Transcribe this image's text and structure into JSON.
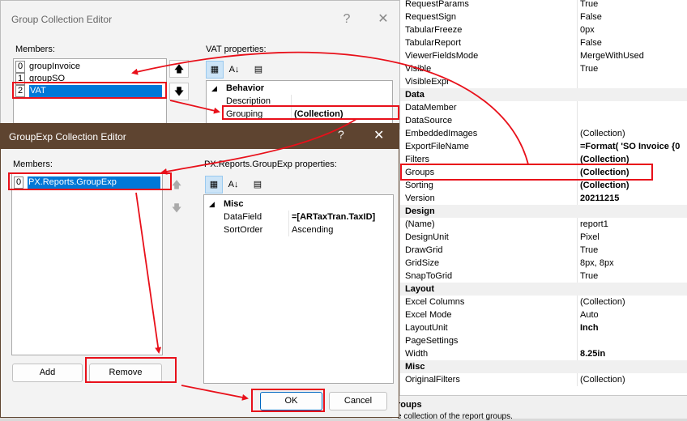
{
  "right_grid": {
    "rows": [
      {
        "name": "RequestParams",
        "value": "True"
      },
      {
        "name": "RequestSign",
        "value": "False"
      },
      {
        "name": "TabularFreeze",
        "value": "0px"
      },
      {
        "name": "TabularReport",
        "value": "False"
      },
      {
        "name": "ViewerFieldsMode",
        "value": "MergeWithUsed"
      },
      {
        "name": "Visible",
        "value": "True"
      },
      {
        "name": "VisibleExpr",
        "value": ""
      },
      {
        "category": "Data"
      },
      {
        "name": "DataMember",
        "value": ""
      },
      {
        "name": "DataSource",
        "value": ""
      },
      {
        "name": "EmbeddedImages",
        "value": "(Collection)"
      },
      {
        "name": "ExportFileName",
        "value": "=Format( 'SO Invoice {0",
        "bold": true
      },
      {
        "name": "Filters",
        "value": "(Collection)",
        "bold": true
      },
      {
        "name": "Groups",
        "value": "(Collection)",
        "bold": true
      },
      {
        "name": "Sorting",
        "value": "(Collection)",
        "bold": true
      },
      {
        "name": "Version",
        "value": "20211215",
        "bold": true
      },
      {
        "category": "Design"
      },
      {
        "name": "(Name)",
        "value": "report1"
      },
      {
        "name": "DesignUnit",
        "value": "Pixel"
      },
      {
        "name": "DrawGrid",
        "value": "True"
      },
      {
        "name": "GridSize",
        "value": "8px, 8px"
      },
      {
        "name": "SnapToGrid",
        "value": "True"
      },
      {
        "category": "Layout"
      },
      {
        "name": "Excel Columns",
        "value": "(Collection)"
      },
      {
        "name": "Excel Mode",
        "value": "Auto"
      },
      {
        "name": "LayoutUnit",
        "value": "Inch",
        "bold": true
      },
      {
        "name": "PageSettings",
        "value": ""
      },
      {
        "name": "Width",
        "value": "8.25in",
        "bold": true
      },
      {
        "category": "Misc"
      },
      {
        "name": "OriginalFilters",
        "value": "(Collection)"
      }
    ],
    "desc_title": "roups",
    "desc_text": "e collection of the report groups."
  },
  "group_editor": {
    "title": "Group Collection Editor",
    "help": "?",
    "close": "✕",
    "members_label": "Members:",
    "props_label": "VAT properties:",
    "items": [
      {
        "index": "0",
        "label": "groupInvoice"
      },
      {
        "index": "1",
        "label": "groupSO"
      },
      {
        "index": "2",
        "label": "VAT"
      }
    ],
    "up_icon": "🡅",
    "down_icon": "🡇",
    "grid": {
      "category": "Behavior",
      "rows": [
        {
          "name": "Description",
          "value": ""
        },
        {
          "name": "Grouping",
          "value": "(Collection)"
        }
      ]
    }
  },
  "groupexp_editor": {
    "title": "GroupExp Collection Editor",
    "help": "?",
    "close": "✕",
    "members_label": "Members:",
    "props_label": "PX.Reports.GroupExp properties:",
    "items": [
      {
        "index": "0",
        "label": "PX.Reports.GroupExp"
      }
    ],
    "up_icon": "🡅",
    "down_icon": "🡇",
    "grid": {
      "category": "Misc",
      "rows": [
        {
          "name": "DataField",
          "value": "=[ARTaxTran.TaxID]"
        },
        {
          "name": "SortOrder",
          "value": "Ascending"
        }
      ]
    },
    "add_label": "Add",
    "remove_label": "Remove",
    "ok_label": "OK",
    "cancel_label": "Cancel"
  },
  "toolbar_icons": {
    "categorized": "▦",
    "alphabetical": "A↓",
    "pages": "▤"
  },
  "colors": {
    "annotation": "#e8101a",
    "titlebar": "#5e4430",
    "selection": "#0078d7"
  }
}
